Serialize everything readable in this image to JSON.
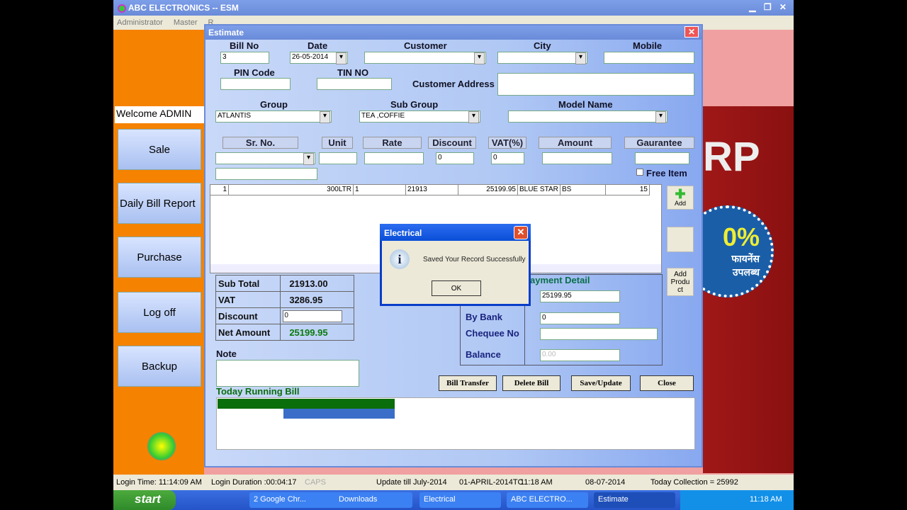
{
  "app": {
    "title": "ABC ELECTRONICS --  ESM",
    "menu": [
      "Administrator",
      "Master",
      "R"
    ]
  },
  "sidebar": {
    "welcome": "Welcome ADMIN",
    "buttons": [
      "Sale",
      "Daily Bill Report",
      "Purchase",
      "Log off",
      "Backup"
    ]
  },
  "estimate": {
    "title": "Estimate",
    "labels": {
      "bill_no": "Bill No",
      "date": "Date",
      "customer": "Customer",
      "city": "City",
      "mobile": "Mobile",
      "pin": "PIN Code",
      "tin": "TIN NO",
      "address": "Customer Address",
      "group": "Group",
      "sub_group": "Sub Group",
      "model": "Model Name",
      "free_item": "Free Item",
      "note": "Note",
      "today_running": "Today Running Bill",
      "payment_detail": "ayment Detail",
      "by_bank": "By Bank",
      "cheque": "Chequee No",
      "balance": "Balance"
    },
    "values": {
      "bill_no": "3",
      "date": "26-05-2014",
      "group": "ATLANTIS",
      "sub_group": "TEA ,COFFIE",
      "discount": "0",
      "vat": "0"
    },
    "columns": [
      "Sr. No.",
      "Unit",
      "Rate",
      "Discount",
      "VAT(%)",
      "Amount",
      "Gaurantee"
    ],
    "rows": [
      [
        "1",
        "300LTR",
        "1",
        "21913",
        "25199.95",
        "BLUE STAR",
        "BS",
        "15"
      ]
    ],
    "totals": {
      "sub_total_label": "Sub Total",
      "sub_total": "21913.00",
      "vat_label": "VAT",
      "vat": "3286.95",
      "discount_label": "Discount",
      "discount": "0",
      "net_label": "Net Amount",
      "net": "25199.95"
    },
    "payment": {
      "cash": "25199.95",
      "by_bank": "0",
      "cheque": "",
      "balance": "0.00"
    },
    "buttons": {
      "add": "Add",
      "add_product": "Add Produ ct",
      "bill_transfer": "Bill Transfer",
      "delete_bill": "Delete Bill",
      "save_update": "Save/Update",
      "close": "Close"
    }
  },
  "dialog": {
    "title": "Electrical",
    "message": "Saved Your Record Successfully",
    "ok": "OK"
  },
  "status": [
    "Login Time: 11:14:09 AM",
    "Login Duration :00:04:17",
    "CAPS",
    "Update till  July-2014",
    "01-APRIL-2014TC",
    "11:18 AM",
    "08-07-2014",
    "Today Collection = 25992"
  ],
  "taskbar": {
    "start": "start",
    "tasks": [
      "2 Google Chr...",
      "Downloads",
      "Electrical",
      "ABC ELECTRO...",
      "Estimate"
    ],
    "clock": "11:18 AM"
  },
  "ad": {
    "text1": "RP",
    "text2": "0%",
    "text3": "फायनेंस उपलब्ध"
  },
  "colors": {
    "orange": "#f58200",
    "green": "#0a6e0a",
    "blue": "#3a6ec8"
  }
}
